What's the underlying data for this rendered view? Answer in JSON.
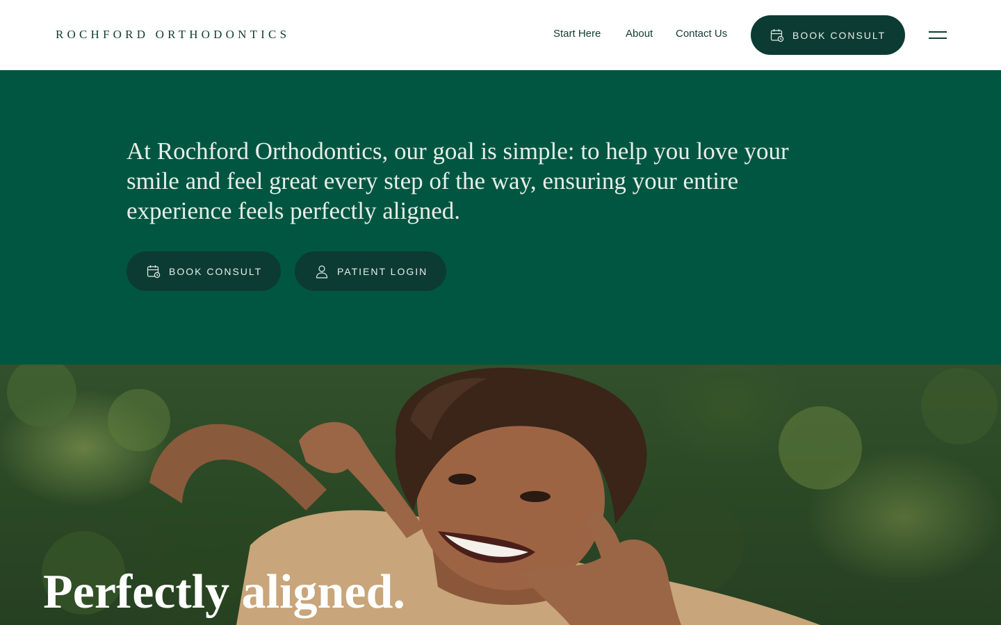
{
  "header": {
    "logo": "ROCHFORD ORTHODONTICS",
    "nav": [
      "Start Here",
      "About",
      "Contact Us"
    ],
    "cta_label": "BOOK CONSULT",
    "menu_icon": "hamburger-icon"
  },
  "hero": {
    "text": "At Rochford Orthodontics, our goal is simple: to help you love your smile and feel great every step of the way, ensuring your entire experience feels perfectly aligned.",
    "buttons": [
      {
        "label": "BOOK CONSULT",
        "icon": "calendar-icon"
      },
      {
        "label": "PATIENT LOGIN",
        "icon": "user-icon"
      }
    ]
  },
  "photo": {
    "title": "Perfectly aligned."
  },
  "colors": {
    "brand_green": "#015641",
    "button_dark": "#0c3b33",
    "text_dark": "#123a30"
  }
}
